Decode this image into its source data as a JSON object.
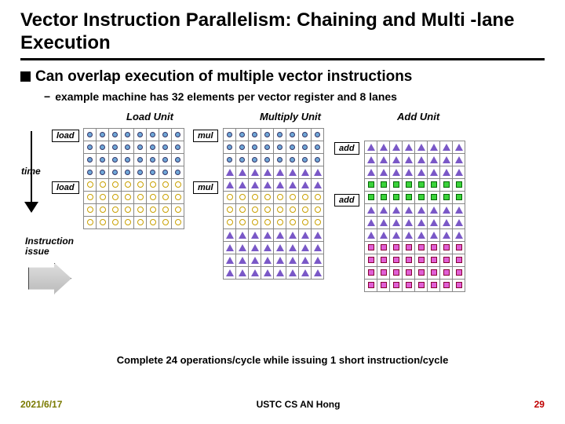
{
  "title": "Vector Instruction Parallelism: Chaining and Multi -lane  Execution",
  "bullet_main": "Can overlap execution of multiple vector instructions",
  "bullet_sub": "example machine has 32 elements per vector register and 8 lanes",
  "units": {
    "load": "Load Unit",
    "mul": "Multiply Unit",
    "add": "Add Unit"
  },
  "tags": {
    "load": "load",
    "mul": "mul",
    "add": "add"
  },
  "time_label": "time",
  "instr_label": "Instruction issue",
  "caption": "Complete 24 operations/cycle while issuing 1 short instruction/cycle",
  "footer": {
    "date": "2021/6/17",
    "author": "USTC CS AN Hong",
    "page": "29"
  }
}
